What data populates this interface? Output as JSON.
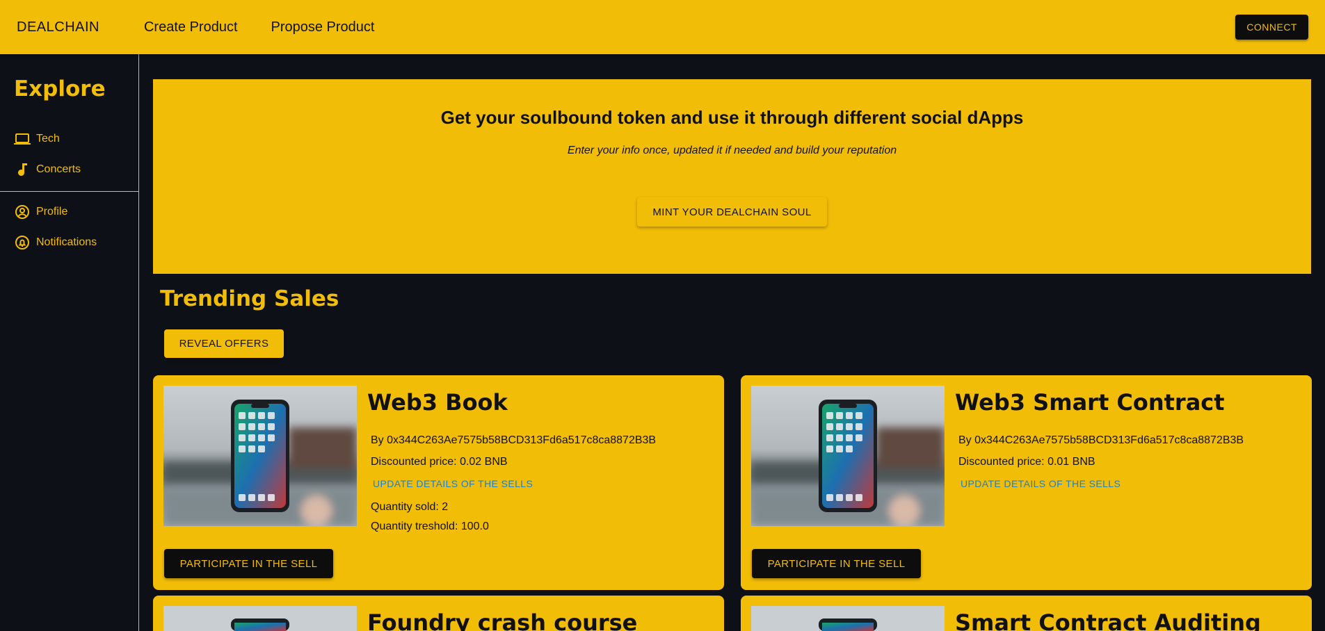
{
  "header": {
    "brand": "DEALCHAIN",
    "nav": [
      "Create Product",
      "Propose Product"
    ],
    "connect_label": "CONNECT"
  },
  "sidebar": {
    "title": "Explore",
    "categories": [
      {
        "label": "Tech",
        "icon": "laptop-icon"
      },
      {
        "label": "Concerts",
        "icon": "music-note-icon"
      }
    ],
    "account": [
      {
        "label": "Profile",
        "icon": "account-circle-icon"
      },
      {
        "label": "Notifications",
        "icon": "notification-bell-icon"
      }
    ]
  },
  "hero": {
    "title": "Get your soulbound token and use it through different social dApps",
    "subtitle": "Enter your info once, updated it if needed and build your reputation",
    "button": "MINT YOUR DEALCHAIN SOUL"
  },
  "trending": {
    "title": "Trending Sales",
    "reveal_label": "REVEAL OFFERS"
  },
  "cards": [
    {
      "title": "Web3 Book",
      "by": "By 0x344C263Ae7575b58BCD313Fd6a517c8ca8872B3B",
      "price": "Discounted price: 0.02 BNB",
      "update_label": "UPDATE DETAILS OF THE SELLS",
      "sold": "Quantity sold: 2",
      "threshold": "Quantity treshold: 100.0",
      "button": "PARTICIPATE IN THE SELL"
    },
    {
      "title": "Web3 Smart Contract",
      "by": "By 0x344C263Ae7575b58BCD313Fd6a517c8ca8872B3B",
      "price": "Discounted price: 0.01 BNB",
      "update_label": "UPDATE DETAILS OF THE SELLS",
      "button": "PARTICIPATE IN THE SELL"
    },
    {
      "title": "Foundry crash course"
    },
    {
      "title": "Smart Contract Auditing"
    }
  ],
  "colors": {
    "accent": "#f2bd07",
    "background": "#0d1117",
    "button_dark": "#0d0d0d",
    "link": "#1f7fc7"
  }
}
